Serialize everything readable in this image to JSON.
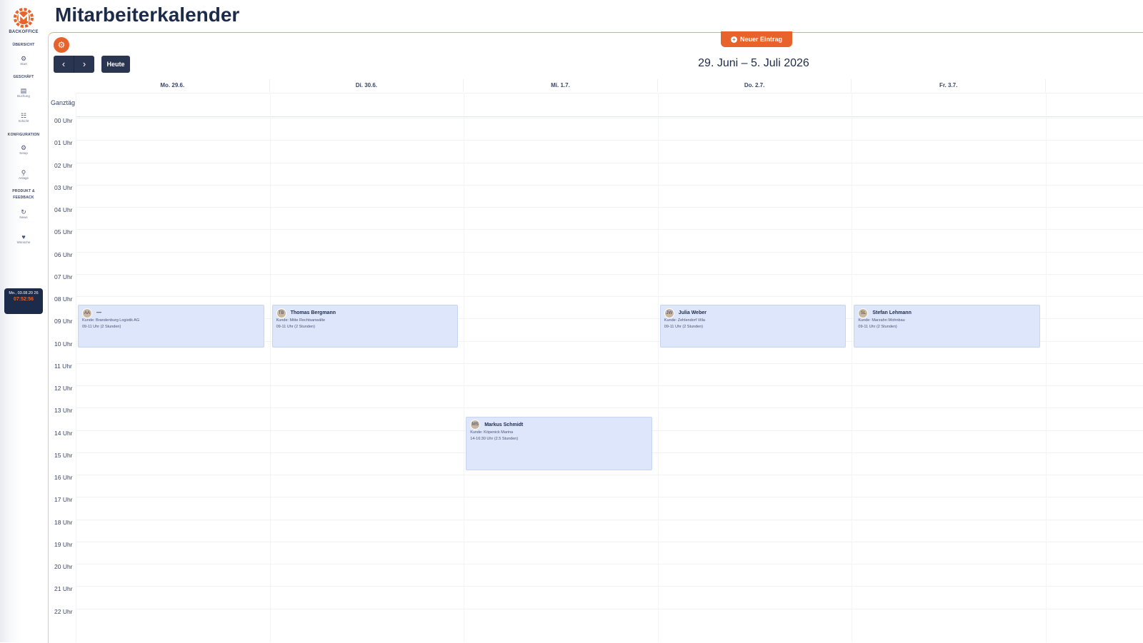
{
  "sidebar": {
    "brand": "BACKOFFICE",
    "sections": [
      {
        "title": "ÜBERSICHT"
      },
      {
        "title": "GESCHÄFT"
      },
      {
        "title": "KONFIGURATION"
      },
      {
        "title": "PRODUKT & FEEDBACK"
      }
    ],
    "items": [
      {
        "icon": "home-icon",
        "label": "Start"
      },
      {
        "icon": "booking-icon",
        "label": "Buchung"
      },
      {
        "icon": "schedule-icon",
        "label": "Schicht"
      },
      {
        "icon": "setup-icon",
        "label": "Setup"
      },
      {
        "icon": "pin-icon",
        "label": "Anlage"
      },
      {
        "icon": "news-icon",
        "label": "News"
      },
      {
        "icon": "wish-icon",
        "label": "Wünsche"
      }
    ],
    "clock": {
      "date": "Mo., 03.08.20 26",
      "time": "07:52:56"
    }
  },
  "header": {
    "title": "Mitarbeiterkalender",
    "new_entry_label": "Neuer Eintrag",
    "today_label": "Heute",
    "prev_icon": "chevron-left-icon",
    "next_icon": "chevron-right-icon",
    "settings_icon": "gear-icon",
    "date_range": "29. Juni – 5. Juli 2026"
  },
  "calendar": {
    "days": [
      "Mo. 29.6.",
      "Di. 30.6.",
      "Mi. 1.7.",
      "Do. 2.7.",
      "Fr. 3.7."
    ],
    "allday_label": "Ganztäg",
    "hours": [
      "00 Uhr",
      "01 Uhr",
      "02 Uhr",
      "03 Uhr",
      "04 Uhr",
      "05 Uhr",
      "06 Uhr",
      "07 Uhr",
      "08 Uhr",
      "09 Uhr",
      "10 Uhr",
      "11 Uhr",
      "12 Uhr",
      "13 Uhr",
      "14 Uhr",
      "15 Uhr",
      "16 Uhr",
      "17 Uhr",
      "18 Uhr",
      "19 Uhr",
      "20 Uhr",
      "21 Uhr",
      "22 Uhr"
    ],
    "events": [
      {
        "day": 0,
        "start": 9,
        "end": 11,
        "avatar": "AA",
        "name": "—",
        "customer": "Kunde: Brandenburg Logistik AG",
        "time": "09-11 Uhr (2 Stunden)"
      },
      {
        "day": 1,
        "start": 9,
        "end": 11,
        "avatar": "TB",
        "name": "Thomas Bergmann",
        "customer": "Kunde: Mitte Rechtsanwälte",
        "time": "09-11 Uhr (2 Stunden)"
      },
      {
        "day": 2,
        "start": 14,
        "end": 16.5,
        "avatar": "MS",
        "name": "Markus Schmidt",
        "customer": "Kunde: Köpenick Marina",
        "time": "14-16:30 Uhr (2.5 Stunden)"
      },
      {
        "day": 3,
        "start": 9,
        "end": 11,
        "avatar": "JW",
        "name": "Julia Weber",
        "customer": "Kunde: Zehlendorf Villa",
        "time": "09-11 Uhr (2 Stunden)"
      },
      {
        "day": 4,
        "start": 9,
        "end": 11,
        "avatar": "SL",
        "name": "Stefan Lehmann",
        "customer": "Kunde: Marzahn Wohnbau",
        "time": "09-11 Uhr (2 Stunden)"
      }
    ]
  },
  "colors": {
    "accent": "#e8632b",
    "navy": "#1d2b4a",
    "event_bg": "#dde6fa"
  }
}
